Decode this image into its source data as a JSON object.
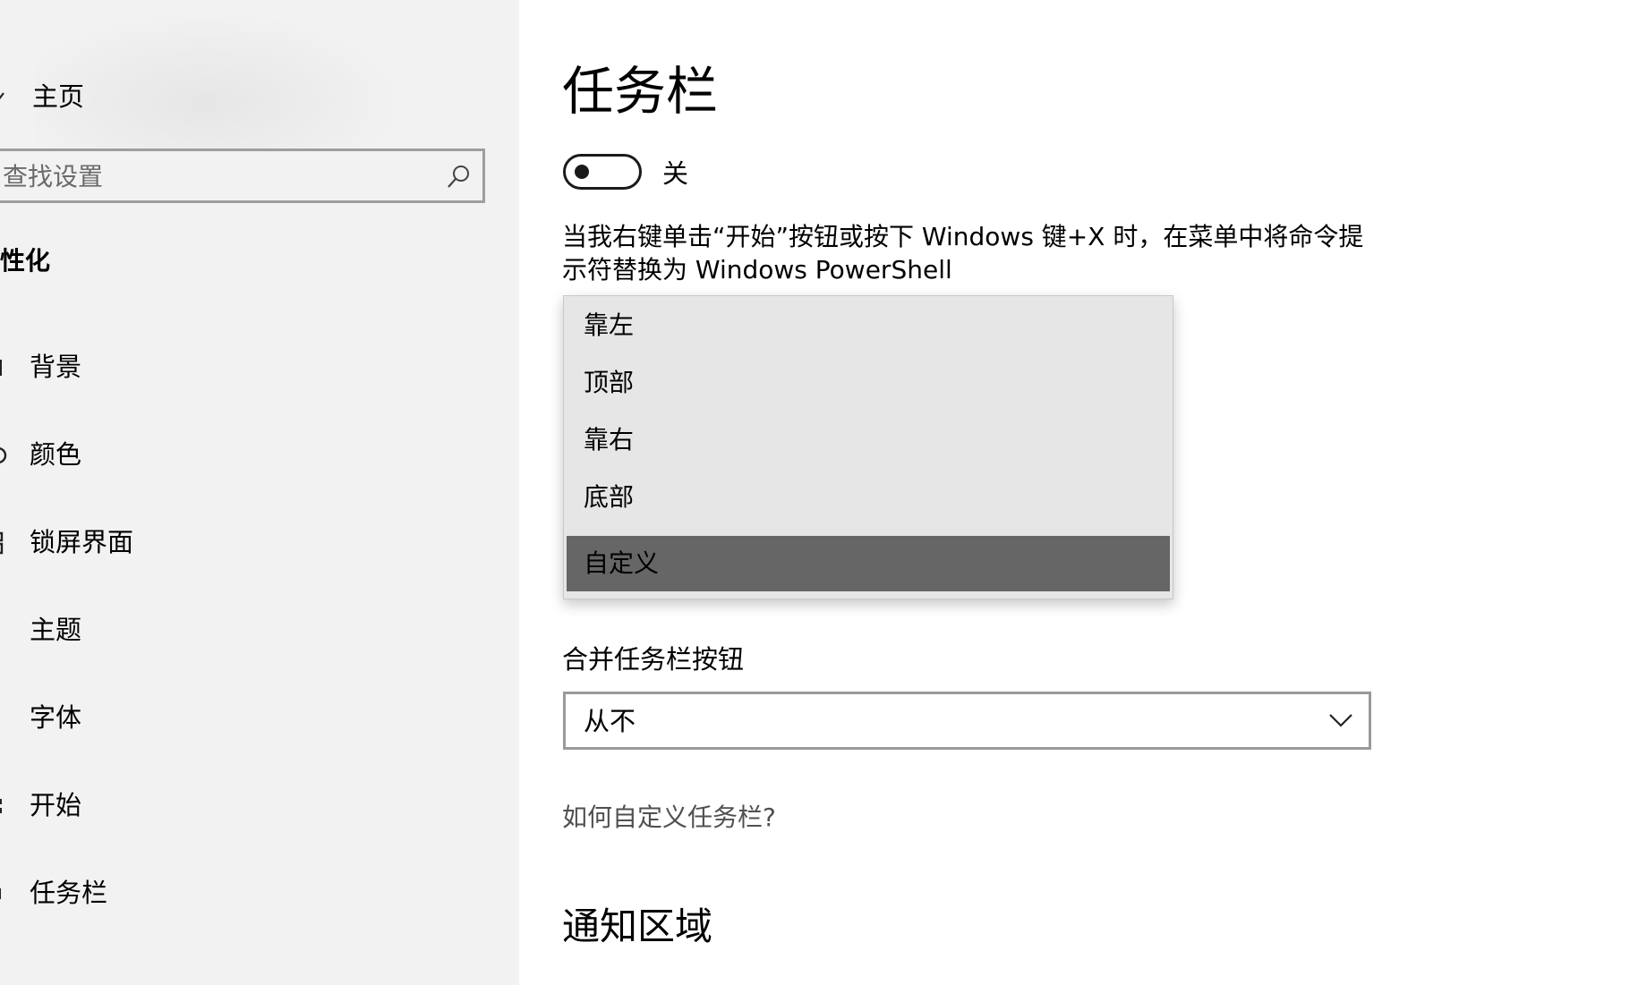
{
  "sidebar": {
    "home_label": "主页",
    "search": {
      "placeholder": "查找设置"
    },
    "section_title": "性化",
    "items": [
      {
        "label": "背景"
      },
      {
        "label": "颜色"
      },
      {
        "label": "锁屏界面"
      },
      {
        "label": "主题"
      },
      {
        "label": "字体"
      },
      {
        "label": "开始"
      },
      {
        "label": "任务栏"
      }
    ]
  },
  "main": {
    "page_title": "任务栏",
    "toggle": {
      "state_label": "关"
    },
    "description": "当我右键单击“开始”按钮或按下 Windows 键+X 时，在菜单中将命令提示符替换为 Windows PowerShell",
    "dropdown": {
      "options": [
        "靠左",
        "顶部",
        "靠右",
        "底部",
        "自定义"
      ],
      "selected": "自定义"
    },
    "combine": {
      "label": "合并任务栏按钮",
      "value": "从不"
    },
    "help_link": "如何自定义任务栏?",
    "notify_title": "通知区域"
  },
  "colors": {
    "sidebar_bg": "#f2f2f2",
    "selected_option_bg": "#666666",
    "menu_bg": "#e6e6e6"
  }
}
